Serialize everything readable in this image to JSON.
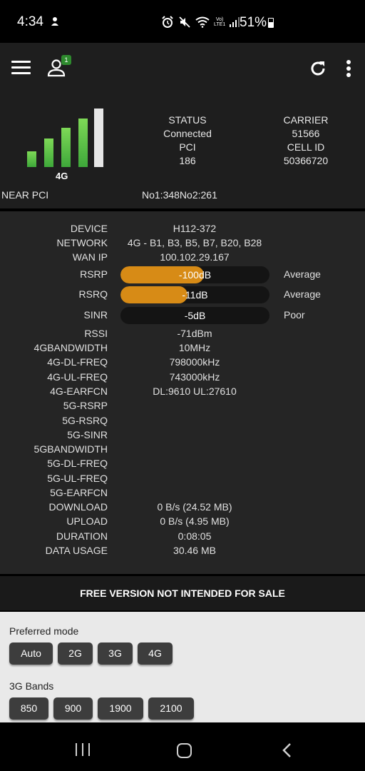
{
  "status_bar": {
    "time": "4:34",
    "battery": "51%"
  },
  "app_bar": {
    "badge_count": "1",
    "icons": [
      "menu-icon",
      "person-icon",
      "refresh-icon",
      "more-vert-icon"
    ]
  },
  "signal": {
    "network_type": "4G",
    "bars_active": 4,
    "bars_total": 5,
    "status_label": "STATUS",
    "status_value": "Connected",
    "pci_label": "PCI",
    "pci_value": "186",
    "carrier_label": "CARRIER",
    "carrier_value": "51566",
    "cellid_label": "CELL ID",
    "cellid_value": "50366720",
    "near_pci_label": "NEAR PCI",
    "near_pci_value": "No1:348No2:261"
  },
  "details": {
    "device": {
      "label": "DEVICE",
      "value": "H112-372"
    },
    "network": {
      "label": "NETWORK",
      "value": "4G - B1, B3, B5, B7, B20, B28"
    },
    "wan_ip": {
      "label": "WAN IP",
      "value": "100.102.29.167"
    },
    "rsrp": {
      "label": "RSRP",
      "value": "-100dB",
      "quality": "Average",
      "fill": 0.56
    },
    "rsrq": {
      "label": "RSRQ",
      "value": "-11dB",
      "quality": "Average",
      "fill": 0.45
    },
    "sinr": {
      "label": "SINR",
      "value": "-5dB",
      "quality": "Poor",
      "fill": 0
    },
    "rssi": {
      "label": "RSSI",
      "value": "-71dBm"
    },
    "bandwidth_4g": {
      "label": "4GBANDWIDTH",
      "value": "10MHz"
    },
    "dl_freq_4g": {
      "label": "4G-DL-FREQ",
      "value": "798000kHz"
    },
    "ul_freq_4g": {
      "label": "4G-UL-FREQ",
      "value": "743000kHz"
    },
    "earfcn_4g": {
      "label": "4G-EARFCN",
      "value": "DL:9610 UL:27610"
    },
    "rsrp_5g": {
      "label": "5G-RSRP",
      "value": ""
    },
    "rsrq_5g": {
      "label": "5G-RSRQ",
      "value": ""
    },
    "sinr_5g": {
      "label": "5G-SINR",
      "value": ""
    },
    "bandwidth_5g": {
      "label": "5GBANDWIDTH",
      "value": ""
    },
    "dl_freq_5g": {
      "label": "5G-DL-FREQ",
      "value": ""
    },
    "ul_freq_5g": {
      "label": "5G-UL-FREQ",
      "value": ""
    },
    "earfcn_5g": {
      "label": "5G-EARFCN",
      "value": ""
    },
    "download": {
      "label": "DOWNLOAD",
      "value": "0 B/s (24.52 MB)"
    },
    "upload": {
      "label": "UPLOAD",
      "value": "0 B/s (4.95 MB)"
    },
    "duration": {
      "label": "DURATION",
      "value": "0:08:05"
    },
    "data_usage": {
      "label": "DATA USAGE",
      "value": "30.46 MB"
    }
  },
  "banner": "FREE VERSION NOT INTENDED FOR SALE",
  "preferred_mode": {
    "title": "Preferred mode",
    "options": [
      "Auto",
      "2G",
      "3G",
      "4G"
    ]
  },
  "bands_3g": {
    "title": "3G Bands",
    "options": [
      "850",
      "900",
      "1900",
      "2100"
    ]
  },
  "colors": {
    "accent": "#d78b16",
    "signal_green": "#5cc449",
    "panel": "#1e1e1e",
    "detail_bg": "#252525"
  }
}
